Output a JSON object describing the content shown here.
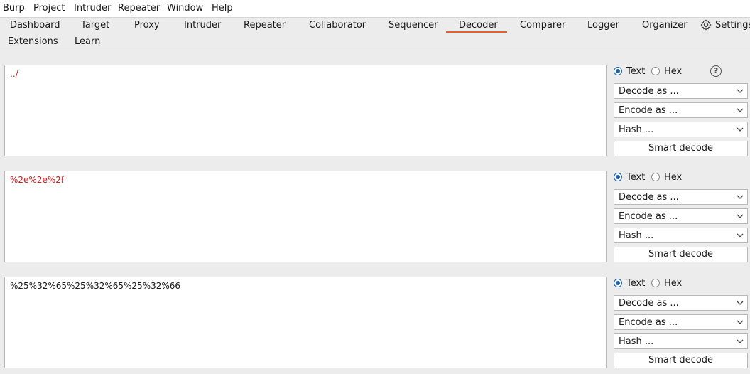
{
  "menu": [
    "Burp",
    "Project",
    "Intruder",
    "Repeater",
    "Window",
    "Help"
  ],
  "tabs": {
    "dashboard": "Dashboard",
    "target": "Target",
    "proxy": "Proxy",
    "intruder": "Intruder",
    "repeater": "Repeater",
    "collaborator": "Collaborator",
    "sequencer": "Sequencer",
    "decoder": "Decoder",
    "comparer": "Comparer",
    "logger": "Logger",
    "organizer": "Organizer",
    "settings": "Settings",
    "extensions": "Extensions",
    "learn": "Learn",
    "active": "Decoder"
  },
  "colors": {
    "accent": "#e8602c",
    "selected_radio": "#1f5fa6",
    "red_text": "#d0191a"
  },
  "panels": [
    {
      "content": "../",
      "content_color": "#d0191a",
      "mode_text": "Text",
      "mode_hex": "Hex",
      "selected_mode": "Text",
      "decode": "Decode as ...",
      "encode": "Encode as ...",
      "hash": "Hash ...",
      "smart": "Smart decode"
    },
    {
      "content": "%2e%2e%2f",
      "content_color": "#d0191a",
      "mode_text": "Text",
      "mode_hex": "Hex",
      "selected_mode": "Text",
      "decode": "Decode as ...",
      "encode": "Encode as ...",
      "hash": "Hash ...",
      "smart": "Smart decode"
    },
    {
      "content": "%25%32%65%25%32%65%25%32%66",
      "content_color": "#1a1a1a",
      "mode_text": "Text",
      "mode_hex": "Hex",
      "selected_mode": "Text",
      "decode": "Decode as ...",
      "encode": "Encode as ...",
      "hash": "Hash ...",
      "smart": "Smart decode"
    }
  ],
  "help_symbol": "?",
  "icons": {
    "settings": "gear-icon",
    "help": "help-icon",
    "dropdown": "chevron-down-icon"
  }
}
